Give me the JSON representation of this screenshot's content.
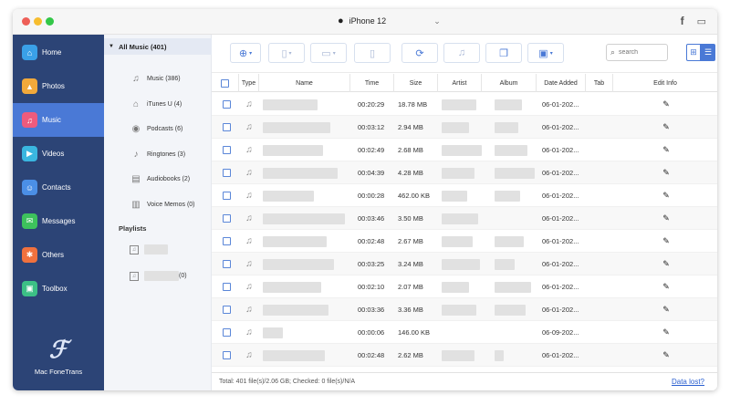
{
  "window": {
    "device_name": "iPhone 12",
    "colors": {
      "close": "#ee5f58",
      "minimize": "#f7bd2f",
      "zoom": "#33c748",
      "sidebar": "#2c4476",
      "active": "#4a79d6"
    }
  },
  "sidebar": {
    "items": [
      {
        "label": "Home",
        "icon": "home-icon",
        "color": "#3aa0e8",
        "glyph": "⌂"
      },
      {
        "label": "Photos",
        "icon": "photos-icon",
        "color": "#f2a93b",
        "glyph": "▲"
      },
      {
        "label": "Music",
        "icon": "music-icon",
        "color": "#ee5b7d",
        "glyph": "♫"
      },
      {
        "label": "Videos",
        "icon": "videos-icon",
        "color": "#3ab6e0",
        "glyph": "▶"
      },
      {
        "label": "Contacts",
        "icon": "contacts-icon",
        "color": "#4b8fe6",
        "glyph": "☺"
      },
      {
        "label": "Messages",
        "icon": "messages-icon",
        "color": "#3dc25c",
        "glyph": "✉"
      },
      {
        "label": "Others",
        "icon": "others-icon",
        "color": "#f0713e",
        "glyph": "✱"
      },
      {
        "label": "Toolbox",
        "icon": "toolbox-icon",
        "color": "#3cc086",
        "glyph": "▣"
      }
    ],
    "active_index": 2,
    "brand": "Mac FoneTrans"
  },
  "subpanel": {
    "header": "All Music (401)",
    "items": [
      {
        "label": "Music (386)",
        "icon": "music-note-icon",
        "glyph": "♫"
      },
      {
        "label": "iTunes U (4)",
        "icon": "itunes-u-icon",
        "glyph": "⌂"
      },
      {
        "label": "Podcasts (6)",
        "icon": "podcast-icon",
        "glyph": "◉"
      },
      {
        "label": "Ringtones (3)",
        "icon": "bell-icon",
        "glyph": "♪"
      },
      {
        "label": "Audiobooks (2)",
        "icon": "audiobook-icon",
        "glyph": "▤"
      },
      {
        "label": "Voice Memos (0)",
        "icon": "voice-memo-icon",
        "glyph": "▥"
      }
    ],
    "playlists_header": "Playlists",
    "playlist_suffix": "(0)"
  },
  "search": {
    "placeholder": "search"
  },
  "table": {
    "columns": [
      "Type",
      "Name",
      "Time",
      "Size",
      "Artist",
      "Album",
      "Date Added",
      "Tab",
      "Edit Info"
    ],
    "rows": [
      {
        "time": "00:20:29",
        "size": "18.78 MB",
        "date": "06-01-202..."
      },
      {
        "time": "00:03:12",
        "size": "2.94 MB",
        "date": "06-01-202..."
      },
      {
        "time": "00:02:49",
        "size": "2.68 MB",
        "date": "06-01-202..."
      },
      {
        "time": "00:04:39",
        "size": "4.28 MB",
        "date": "06-01-202..."
      },
      {
        "time": "00:00:28",
        "size": "462.00 KB",
        "date": "06-01-202..."
      },
      {
        "time": "00:03:46",
        "size": "3.50 MB",
        "date": "06-01-202..."
      },
      {
        "time": "00:02:48",
        "size": "2.67 MB",
        "date": "06-01-202..."
      },
      {
        "time": "00:03:25",
        "size": "3.24 MB",
        "date": "06-01-202..."
      },
      {
        "time": "00:02:10",
        "size": "2.07 MB",
        "date": "06-01-202..."
      },
      {
        "time": "00:03:36",
        "size": "3.36 MB",
        "date": "06-01-202..."
      },
      {
        "time": "00:00:06",
        "size": "146.00 KB",
        "date": "06-09-202..."
      },
      {
        "time": "00:02:48",
        "size": "2.62 MB",
        "date": "06-01-202..."
      }
    ]
  },
  "footer": {
    "summary": "Total: 401 file(s)/2.06 GB; Checked: 0 file(s)/N/A",
    "link": "Data lost?"
  }
}
